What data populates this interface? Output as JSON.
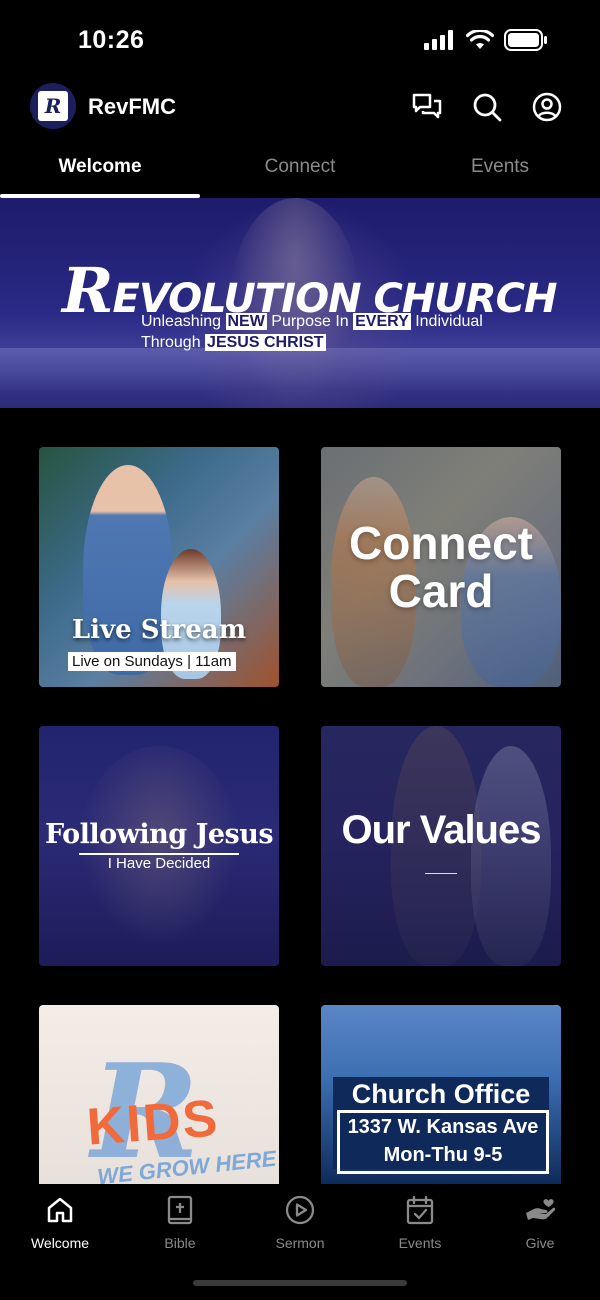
{
  "status_bar": {
    "time": "10:26",
    "icons": [
      "signal-icon",
      "wifi-icon",
      "battery-icon"
    ]
  },
  "header": {
    "logo_letter": "R",
    "title": "RevFMC",
    "actions": [
      "chat-icon",
      "search-icon",
      "profile-icon"
    ]
  },
  "tabs": [
    {
      "label": "Welcome",
      "active": true
    },
    {
      "label": "Connect",
      "active": false
    },
    {
      "label": "Events",
      "active": false
    }
  ],
  "hero": {
    "title_first": "R",
    "title_rest": "EVOLUTION CHURCH",
    "line1_a": "Unleashing ",
    "line1_b": "NEW",
    "line1_c": " Purpose In ",
    "line1_d": "EVERY",
    "line1_e": " Individual",
    "line2_a": "Through ",
    "line2_b": "JESUS CHRIST"
  },
  "tiles": {
    "live_stream": {
      "title": "Live Stream",
      "subtitle": "Live on Sundays | 11am"
    },
    "connect_card": {
      "line1": "Connect",
      "line2": "Card"
    },
    "following_jesus": {
      "title": "Following Jesus",
      "subtitle": "I Have Decided"
    },
    "our_values": {
      "title": "Our Values"
    },
    "kids": {
      "text": "KIDS",
      "sub": "WE GROW HERE"
    },
    "church_office": {
      "title": "Church Office",
      "address": "1337 W. Kansas Ave",
      "hours": "Mon-Thu 9-5"
    }
  },
  "bottom_nav": [
    {
      "label": "Welcome",
      "icon": "home-icon",
      "active": true
    },
    {
      "label": "Bible",
      "icon": "bible-icon",
      "active": false
    },
    {
      "label": "Sermon",
      "icon": "play-icon",
      "active": false
    },
    {
      "label": "Events",
      "icon": "calendar-icon",
      "active": false
    },
    {
      "label": "Give",
      "icon": "give-icon",
      "active": false
    }
  ],
  "colors": {
    "background": "#000000",
    "accent": "#1d1b6a",
    "inactive": "#8a8a8a"
  }
}
